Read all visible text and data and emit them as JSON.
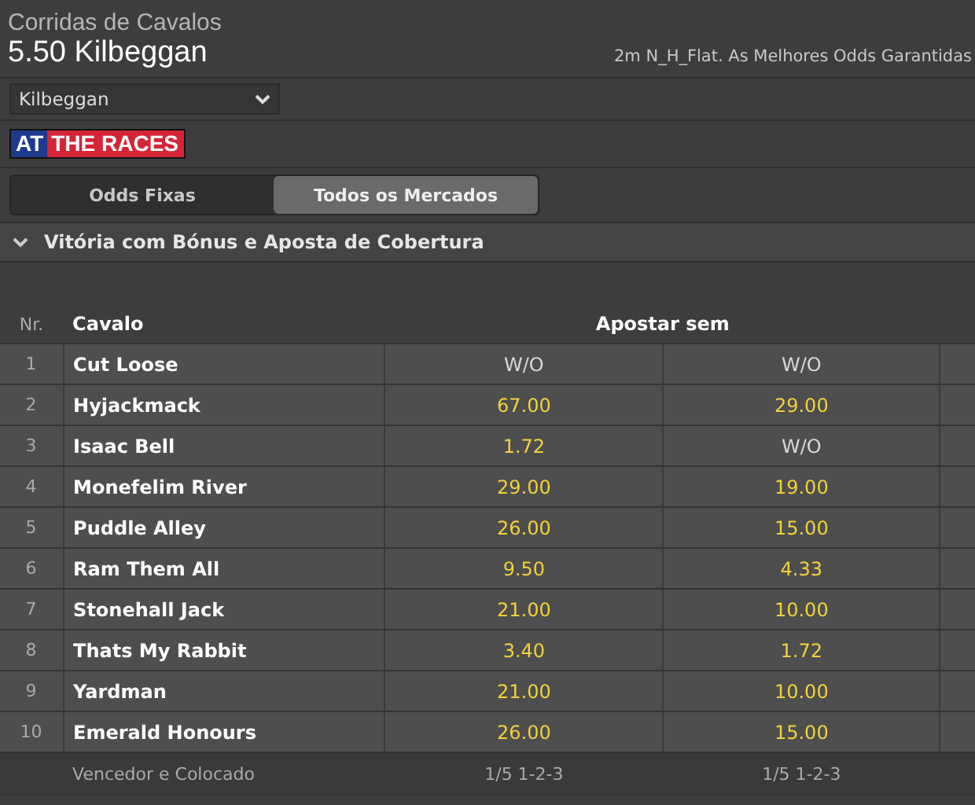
{
  "category": "Corridas de Cavalos",
  "race_title": "5.50 Kilbeggan",
  "race_info": "2m N_H_Flat. As Melhores Odds Garantidas",
  "course_select": {
    "value": "Kilbeggan"
  },
  "logo": {
    "part_1": "AT",
    "part_2": "THE RACES"
  },
  "tabs": [
    {
      "label": "Odds Fixas",
      "selected": false
    },
    {
      "label": "Todos os Mercados",
      "selected": true
    }
  ],
  "market": {
    "title": "Vitória com Bónus e Aposta de Cobertura",
    "expanded": true
  },
  "table": {
    "columns": {
      "number": "Nr.",
      "horse": "Cavalo",
      "odds": "Apostar sem"
    },
    "rows": [
      {
        "number": "1",
        "horse": "Cut Loose",
        "odds": [
          {
            "text": "W/O",
            "kind": "void"
          },
          {
            "text": "W/O",
            "kind": "void"
          }
        ]
      },
      {
        "number": "2",
        "horse": "Hyjackmack",
        "odds": [
          {
            "text": "67.00",
            "kind": "price"
          },
          {
            "text": "29.00",
            "kind": "price"
          }
        ]
      },
      {
        "number": "3",
        "horse": "Isaac Bell",
        "odds": [
          {
            "text": "1.72",
            "kind": "price"
          },
          {
            "text": "W/O",
            "kind": "void"
          }
        ]
      },
      {
        "number": "4",
        "horse": "Monefelim River",
        "odds": [
          {
            "text": "29.00",
            "kind": "price"
          },
          {
            "text": "19.00",
            "kind": "price"
          }
        ]
      },
      {
        "number": "5",
        "horse": "Puddle Alley",
        "odds": [
          {
            "text": "26.00",
            "kind": "price"
          },
          {
            "text": "15.00",
            "kind": "price"
          }
        ]
      },
      {
        "number": "6",
        "horse": "Ram Them All",
        "odds": [
          {
            "text": "9.50",
            "kind": "price"
          },
          {
            "text": "4.33",
            "kind": "price"
          }
        ]
      },
      {
        "number": "7",
        "horse": "Stonehall Jack",
        "odds": [
          {
            "text": "21.00",
            "kind": "price"
          },
          {
            "text": "10.00",
            "kind": "price"
          }
        ]
      },
      {
        "number": "8",
        "horse": "Thats My Rabbit",
        "odds": [
          {
            "text": "3.40",
            "kind": "price"
          },
          {
            "text": "1.72",
            "kind": "price"
          }
        ]
      },
      {
        "number": "9",
        "horse": "Yardman",
        "odds": [
          {
            "text": "21.00",
            "kind": "price"
          },
          {
            "text": "10.00",
            "kind": "price"
          }
        ]
      },
      {
        "number": "10",
        "horse": "Emerald Honours",
        "odds": [
          {
            "text": "26.00",
            "kind": "price"
          },
          {
            "text": "15.00",
            "kind": "price"
          }
        ]
      }
    ],
    "footer": {
      "label": "Vencedor e Colocado",
      "terms": [
        "1/5 1-2-3",
        "1/5 1-2-3"
      ]
    }
  }
}
